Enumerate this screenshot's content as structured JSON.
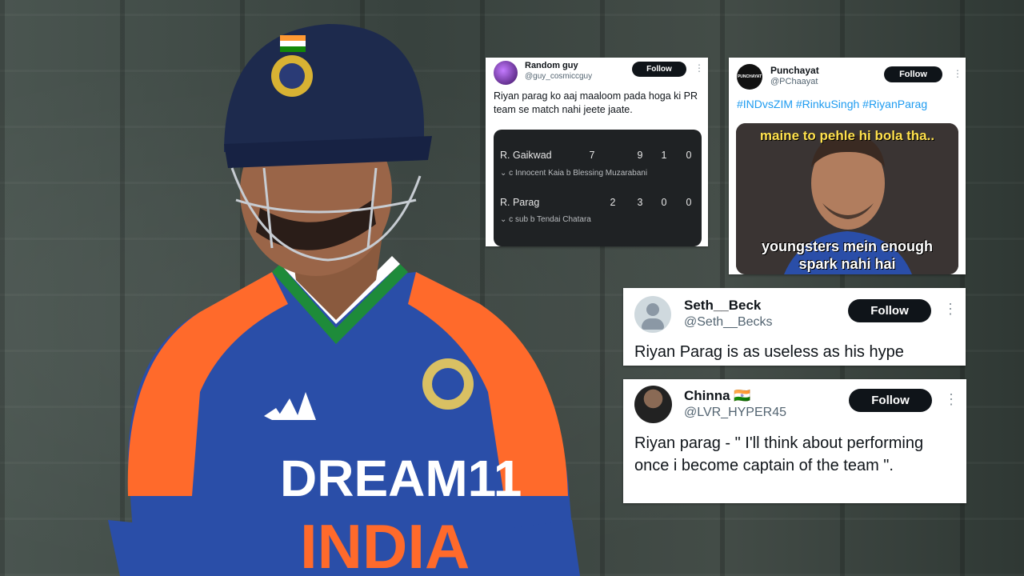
{
  "tweets": [
    {
      "name": "Random guy",
      "handle": "@guy_cosmiccguy",
      "follow_label": "Follow",
      "text": "Riyan parag ko aaj maaloom pada hoga ki PR team se match nahi jeete jaate.",
      "scorecard": [
        {
          "player": "R. Gaikwad",
          "runs": "7",
          "balls": "9",
          "fours": "1",
          "sixes": "0",
          "dismissal": "c Innocent Kaia b Blessing Muzarabani"
        },
        {
          "player": "R. Parag",
          "runs": "2",
          "balls": "3",
          "fours": "0",
          "sixes": "0",
          "dismissal": "c sub b Tendai Chatara"
        }
      ]
    },
    {
      "name": "Punchayat",
      "handle": "@PChaayat",
      "follow_label": "Follow",
      "avatar_text": "PUNCHAYAT",
      "hashtags": "#INDvsZIM #RinkuSingh #RiyanParag",
      "meme_top": "maine to pehle hi bola tha..",
      "meme_bottom_1": "youngsters mein enough",
      "meme_bottom_2": "spark nahi hai"
    },
    {
      "name": "Seth__Beck",
      "handle": "@Seth__Becks",
      "follow_label": "Follow",
      "text": "Riyan Parag is as useless as his hype"
    },
    {
      "name": "Chinna 🇮🇳",
      "handle": "@LVR_HYPER45",
      "follow_label": "Follow",
      "text": "Riyan parag - \" I'll think about performing once i become captain of the team \"."
    }
  ],
  "jersey": {
    "sponsor": "DREAM11",
    "country": "INDIA"
  },
  "colors": {
    "jersey_blue": "#2a4ea8",
    "jersey_orange": "#ff6a2b",
    "follow_bg": "#0f1419",
    "hashtag": "#1d9bf0"
  }
}
